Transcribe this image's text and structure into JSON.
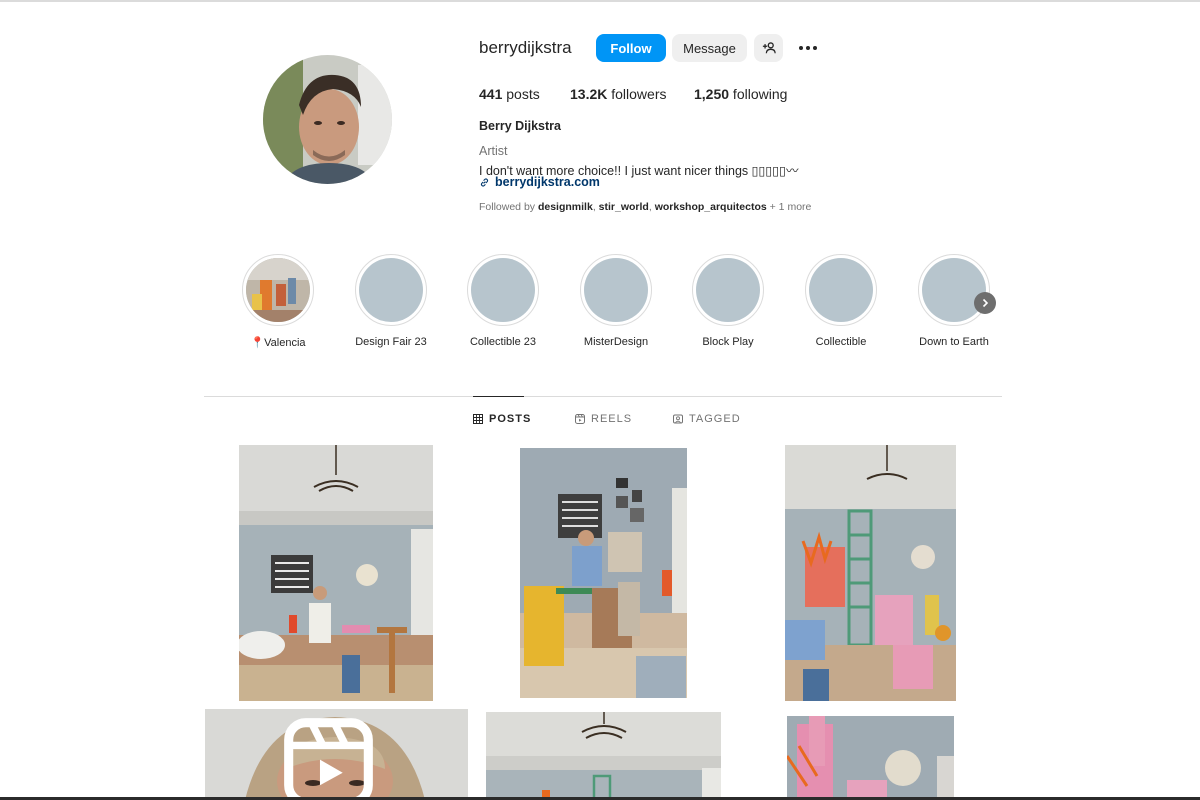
{
  "profile": {
    "username": "berrydijkstra",
    "follow_label": "Follow",
    "message_label": "Message",
    "posts_count": "441",
    "posts_label": " posts",
    "followers_count": "13.2K",
    "followers_label": " followers",
    "following_count": "1,250",
    "following_label": " following",
    "full_name": "Berry Dijkstra",
    "category": "Artist",
    "bio": "I don't want more choice!! I just want nicer things ▯▯▯▯▯〰",
    "link": "berrydijkstra.com",
    "followed_by_prefix": "Followed by ",
    "followed_by_1": "designmilk",
    "followed_by_2": "stir_world",
    "followed_by_3": "workshop_arquitectos",
    "followed_by_suffix": " + 1 more"
  },
  "highlights": [
    {
      "label": "📍Valencia"
    },
    {
      "label": "Design Fair 23"
    },
    {
      "label": "Collectible 23"
    },
    {
      "label": "MisterDesign"
    },
    {
      "label": "Block Play"
    },
    {
      "label": "Collectible"
    },
    {
      "label": "Down to Earth"
    }
  ],
  "tabs": {
    "posts": "POSTS",
    "reels": "REELS",
    "tagged": "TAGGED"
  },
  "icons": {
    "adduser": "add-user-icon",
    "more": "more-options-icon",
    "link": "link-icon",
    "next": "chevron-right-icon",
    "posts": "grid-icon",
    "reels": "reels-icon",
    "tagged": "tagged-icon"
  },
  "colors": {
    "accent": "#0095f6",
    "link": "#00376b",
    "muted": "#737373",
    "highlight_placeholder": "#b7c5cd"
  }
}
